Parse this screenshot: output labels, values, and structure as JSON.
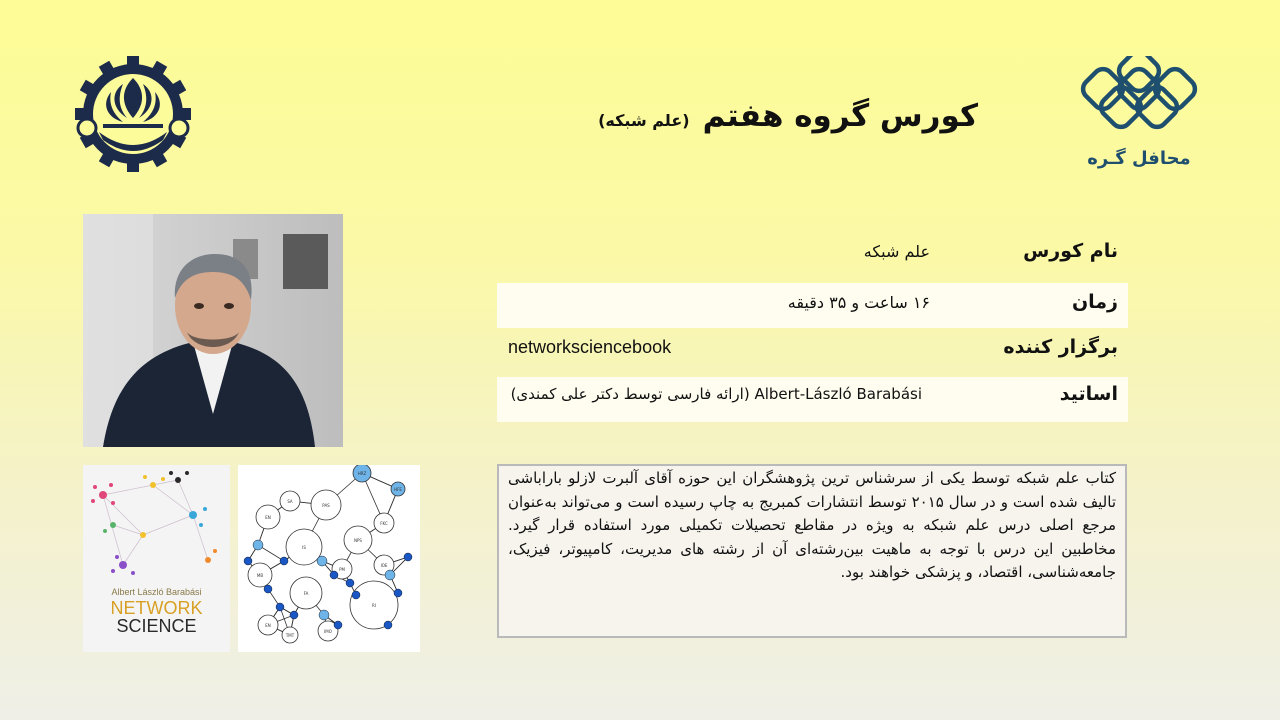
{
  "header": {
    "title": "کورس گروه هفتم",
    "subtitle": "(علم شبکه)",
    "left_logo_icon": "university-emblem-icon",
    "right_logo_icon": "interlocking-knot-icon",
    "right_logo_text": "محافل گـره"
  },
  "info": {
    "course_name": {
      "label": "نام کورس",
      "value": "علم شبکه"
    },
    "duration": {
      "label": "زمان",
      "value": "۱۶ ساعت و ۳۵ دقیقه"
    },
    "organizer": {
      "label": "برگزار کننده",
      "value": "networksciencebook"
    },
    "instructors": {
      "label": "اساتید",
      "value": "Albert-László Barabási (ارائه فارسی توسط دکتر علی کمندی)"
    }
  },
  "description": "کتاب علم شبکه توسط یکی از سرشناس ترین پژوهشگران این حوزه آقای آلبرت لازلو باراباشی تالیف شده است و در سال ۲۰۱۵ توسط انتشارات کمبریج به چاپ رسیده است و می‌تواند به‌عنوان مرجع اصلی درس علم شبکه به ویژه در مقاطع تحصیلات تکمیلی مورد استفاده قرار گیرد. مخاطبین این درس با توجه به ماهیت بین‌رشته‌ای آن از رشته های مدیریت، کامپیوتر، فیزیک، جامعه‌شناسی، اقتصاد، و پزشکی خواهند بود.",
  "book": {
    "author": "Albert László Barabási",
    "title_line1": "NETWORK",
    "title_line2": "SCIENCE"
  },
  "network_graph": {
    "node_labels": [
      "HRZ",
      "EN",
      "PAS",
      "NPS",
      "FKC",
      "IS",
      "MB",
      "FA",
      "RI",
      "EN",
      "IMO",
      "IOE",
      "PM",
      "SA",
      "HFE",
      "TMT"
    ]
  },
  "colors": {
    "title_text": "#111111",
    "logo_blue": "#1f4f6e",
    "emblem_navy": "#1c2b4a",
    "graph_node_blue": "#1a56c4"
  }
}
